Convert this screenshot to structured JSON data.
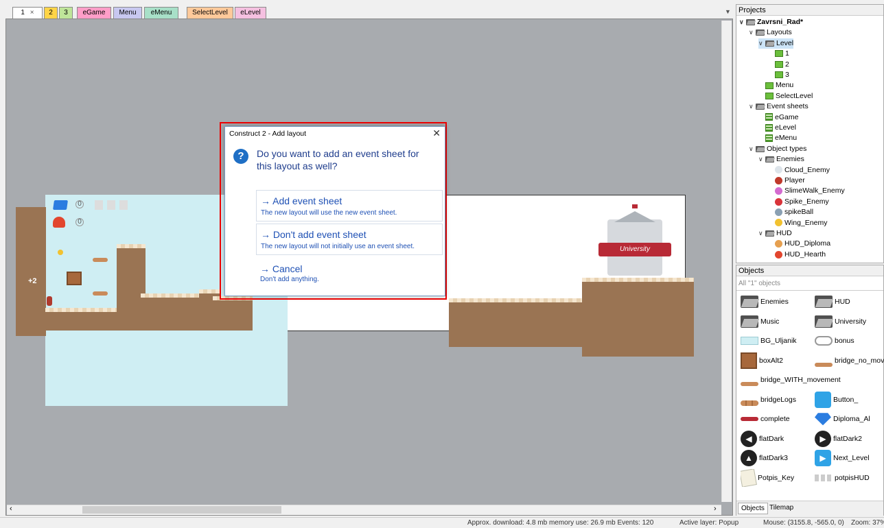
{
  "tabs": [
    {
      "label": "1",
      "color": "#ffffff"
    },
    {
      "label": "2",
      "color": "#ffd447"
    },
    {
      "label": "3",
      "color": "#bfe59a"
    },
    {
      "label": "eGame",
      "color": "#ff9ec8"
    },
    {
      "label": "Menu",
      "color": "#c8c8f0"
    },
    {
      "label": "eMenu",
      "color": "#a8e0c8"
    },
    {
      "label": "SelectLevel",
      "color": "#ffc99a"
    },
    {
      "label": "eLevel",
      "color": "#f5c0e0"
    }
  ],
  "tab_close": "×",
  "canvas": {
    "bonus_label": "+2",
    "hud_counter_1": "0",
    "hud_counter_2": "0",
    "building_sign": "University"
  },
  "dialog": {
    "title": "Construct 2 - Add layout",
    "close": "✕",
    "question": "Do you want to add an event sheet for this layout as well?",
    "question_icon": "?",
    "options": [
      {
        "label": "→ Add event sheet",
        "desc": "The new layout will use the new event sheet."
      },
      {
        "label": "→ Don't add event sheet",
        "desc": "The new layout will not initially use an event sheet."
      },
      {
        "label": "→ Cancel",
        "desc": "Don't add anything."
      }
    ]
  },
  "projects": {
    "title": "Projects",
    "tree": [
      {
        "label": "Zavrsni_Rad*",
        "type": "folder",
        "level": 0,
        "bold": true
      },
      {
        "label": "Layouts",
        "type": "folder",
        "level": 1
      },
      {
        "label": "Level",
        "type": "folder",
        "level": 2,
        "selected": true
      },
      {
        "label": "1",
        "type": "layout",
        "level": 3
      },
      {
        "label": "2",
        "type": "layout",
        "level": 3
      },
      {
        "label": "3",
        "type": "layout",
        "level": 3
      },
      {
        "label": "Menu",
        "type": "layout",
        "level": 2
      },
      {
        "label": "SelectLevel",
        "type": "layout",
        "level": 2
      },
      {
        "label": "Event sheets",
        "type": "folder",
        "level": 1
      },
      {
        "label": "eGame",
        "type": "event",
        "level": 2
      },
      {
        "label": "eLevel",
        "type": "event",
        "level": 2
      },
      {
        "label": "eMenu",
        "type": "event",
        "level": 2
      },
      {
        "label": "Object types",
        "type": "folder",
        "level": 1
      },
      {
        "label": "Enemies",
        "type": "folder",
        "level": 2
      },
      {
        "label": "Cloud_Enemy",
        "type": "obj",
        "level": 3,
        "color": "#dde4ea"
      },
      {
        "label": "Player",
        "type": "obj",
        "level": 3,
        "color": "#c0392b"
      },
      {
        "label": "SlimeWalk_Enemy",
        "type": "obj",
        "level": 3,
        "color": "#d46bd0"
      },
      {
        "label": "Spike_Enemy",
        "type": "obj",
        "level": 3,
        "color": "#d9343a"
      },
      {
        "label": "spikeBall",
        "type": "obj",
        "level": 3,
        "color": "#8aa0b3"
      },
      {
        "label": "Wing_Enemy",
        "type": "obj",
        "level": 3,
        "color": "#f2c230"
      },
      {
        "label": "HUD",
        "type": "folder",
        "level": 2
      },
      {
        "label": "HUD_Diploma",
        "type": "obj",
        "level": 3,
        "color": "#e6a050"
      },
      {
        "label": "HUD_Hearth",
        "type": "obj",
        "level": 3,
        "color": "#e2462e"
      }
    ]
  },
  "objects": {
    "title": "Objects",
    "filter": "All \"1\" objects",
    "items": [
      {
        "label": "Enemies",
        "icon": "folder"
      },
      {
        "label": "HUD",
        "icon": "folder"
      },
      {
        "label": "Music",
        "icon": "folder"
      },
      {
        "label": "University",
        "icon": "folder"
      },
      {
        "label": "BG_Uljanik",
        "icon": "bg"
      },
      {
        "label": "bonus",
        "icon": "bonus"
      },
      {
        "label": "boxAlt2",
        "icon": "box"
      },
      {
        "label": "bridge_no_mov",
        "icon": "bridge"
      },
      {
        "label": "bridge_WITH_movement",
        "icon": "bridge"
      },
      {
        "label": "",
        "icon": "none"
      },
      {
        "label": "bridgeLogs",
        "icon": "logs"
      },
      {
        "label": "Button_",
        "icon": "home"
      },
      {
        "label": "complete",
        "icon": "ribbon"
      },
      {
        "label": "Diploma_Al",
        "icon": "gem"
      },
      {
        "label": "flatDark",
        "icon": "arrow-left"
      },
      {
        "label": "flatDark2",
        "icon": "arrow-right"
      },
      {
        "label": "flatDark3",
        "icon": "arrow-up"
      },
      {
        "label": "Next_Level",
        "icon": "play"
      },
      {
        "label": "Potpis_Key",
        "icon": "key"
      },
      {
        "label": "potpisHUD",
        "icon": "potpis"
      }
    ],
    "bottom_tabs": [
      "Objects",
      "Tilemap"
    ]
  },
  "status": {
    "download": "Approx. download: 4.8 mb  memory use: 26.9 mb  Events: 120",
    "layer": "Active layer: Popup",
    "mouse": "Mouse: (3155.8, -565.0, 0)",
    "zoom": "Zoom: 37%"
  }
}
